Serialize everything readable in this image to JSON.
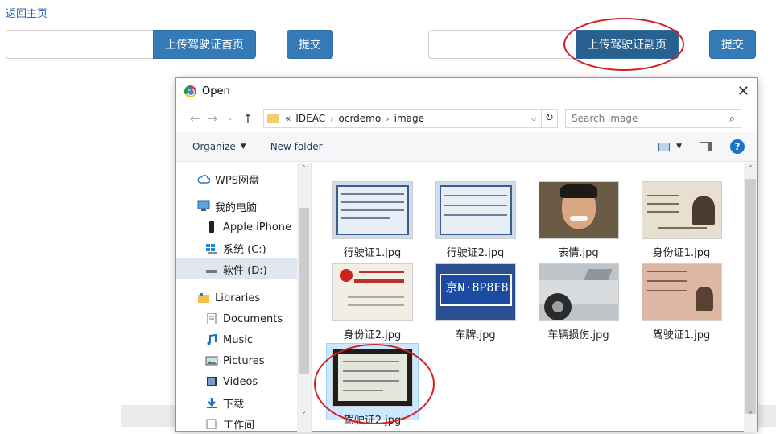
{
  "page": {
    "back_link": "返回主页",
    "upload_front_label": "上传驾驶证首页",
    "upload_back_label": "上传驾驶证副页",
    "submit_label": "提交"
  },
  "dialog": {
    "title": "Open",
    "path": [
      "IDEAC",
      "ocrdemo",
      "image"
    ],
    "path_prefix": "«",
    "search_placeholder": "Search image",
    "toolbar": {
      "organize": "Organize",
      "new_folder": "New folder"
    },
    "nav": [
      {
        "label": "WPS网盘",
        "icon": "cloud-icon"
      },
      {
        "label": "我的电脑",
        "icon": "computer-icon"
      },
      {
        "label": "Apple iPhone",
        "icon": "phone-icon"
      },
      {
        "label": "系统 (C:)",
        "icon": "windows-drive-icon"
      },
      {
        "label": "软件 (D:)",
        "icon": "drive-icon"
      },
      {
        "label": "Libraries",
        "icon": "libraries-icon"
      },
      {
        "label": "Documents",
        "icon": "documents-icon"
      },
      {
        "label": "Music",
        "icon": "music-icon"
      },
      {
        "label": "Pictures",
        "icon": "pictures-icon"
      },
      {
        "label": "Videos",
        "icon": "videos-icon"
      },
      {
        "label": "下载",
        "icon": "download-icon"
      },
      {
        "label": "工作间",
        "icon": "folder-icon"
      }
    ],
    "files": [
      {
        "name": "行驶证1.jpg"
      },
      {
        "name": "行驶证2.jpg"
      },
      {
        "name": "表情.jpg"
      },
      {
        "name": "身份证1.jpg"
      },
      {
        "name": "身份证2.jpg"
      },
      {
        "name": "车牌.jpg",
        "plate_text": "京N·8P8F8"
      },
      {
        "name": "车辆损伤.jpg"
      },
      {
        "name": "驾驶证1.jpg"
      },
      {
        "name": "驾驶证2.jpg"
      }
    ]
  },
  "colors": {
    "accent": "#337ab7",
    "highlight_ring": "#d62020",
    "selection": "#cce8ff"
  }
}
